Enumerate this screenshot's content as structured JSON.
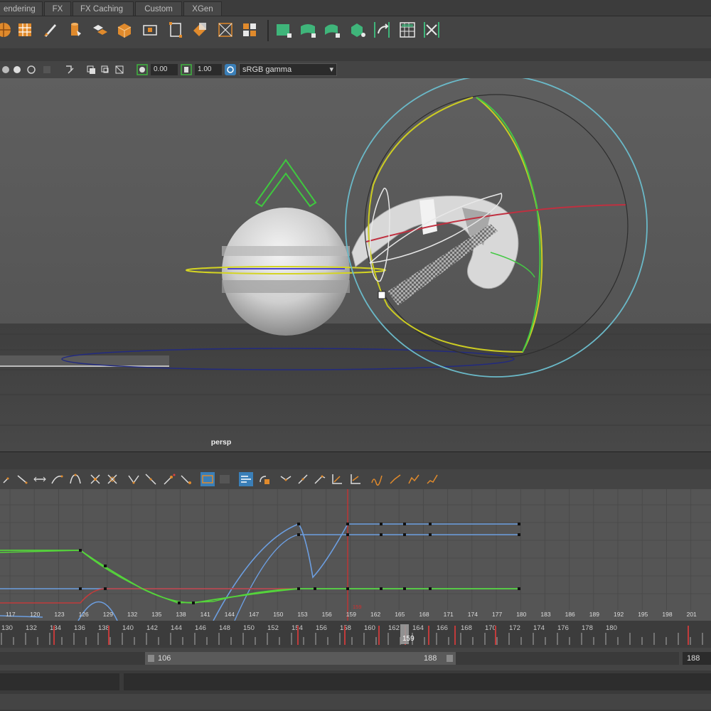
{
  "shelf_tabs": [
    "endering",
    "FX",
    "FX Caching",
    "Custom",
    "XGen"
  ],
  "shelf_icons": [
    "poly-sphere-icon",
    "grid-cube-icon",
    "brush-icon",
    "cylinder-icon",
    "combine-icon",
    "plane-icon",
    "cube-icon",
    "bevel-icon",
    "bounding-box-icon",
    "extrude-icon",
    "quad-fill-icon",
    "paint-weights-icon",
    "wrap-deformer-icon",
    "blend-shape-icon",
    "cluster-icon",
    "bend-deformer-icon",
    "lattice-icon",
    "nonlinear-icon"
  ],
  "viewport_toolbar": {
    "exposure_value": "0.00",
    "gamma_value": "1.00",
    "color_space": "sRGB gamma",
    "color_space_arrow": "▾"
  },
  "viewport": {
    "camera_label": "persp"
  },
  "graph": {
    "frame_labels": [
      "117",
      "120",
      "123",
      "126",
      "129",
      "132",
      "135",
      "138",
      "141",
      "144",
      "147",
      "150",
      "153",
      "156",
      "159",
      "162",
      "165",
      "168",
      "171",
      "174",
      "177",
      "180",
      "183",
      "186",
      "189",
      "192",
      "195",
      "198",
      "201"
    ],
    "current_frame_marker": "159",
    "colors": {
      "green": "#55d43b",
      "blue": "#6c9ee0",
      "red": "#c23b3b",
      "current_time": "#d42d2d"
    }
  },
  "time_slider": {
    "tick_labels": [
      "130",
      "132",
      "134",
      "136",
      "138",
      "140",
      "142",
      "144",
      "146",
      "148",
      "150",
      "152",
      "154",
      "156",
      "158",
      "160",
      "162",
      "164",
      "166",
      "168",
      "170",
      "172",
      "174",
      "176",
      "178",
      "180"
    ],
    "current_frame": "159"
  },
  "range": {
    "start": "106",
    "end": "188",
    "end_field": "188"
  }
}
